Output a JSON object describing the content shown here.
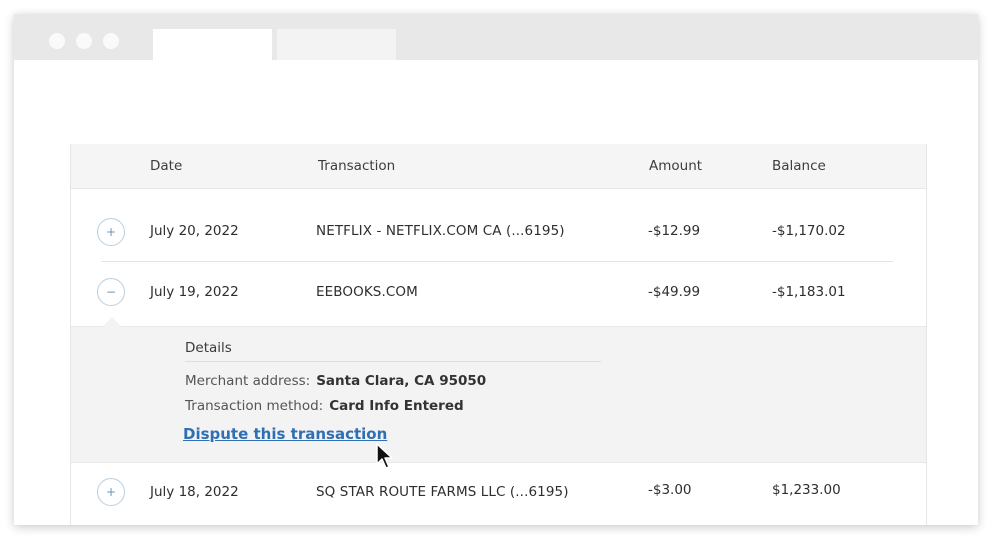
{
  "table": {
    "headers": {
      "date": "Date",
      "transaction": "Transaction",
      "amount": "Amount",
      "balance": "Balance"
    },
    "rows": [
      {
        "toggle": "+",
        "date": "July 20, 2022",
        "transaction": "NETFLIX - NETFLIX.COM  CA (...6195)",
        "amount": "-$12.99",
        "balance": "-$1,170.02"
      },
      {
        "toggle": "−",
        "date": "July 19, 2022",
        "transaction": "EEBOOKS.COM",
        "amount": "-$49.99",
        "balance": "-$1,183.01"
      },
      {
        "toggle": "+",
        "date": "July 18, 2022",
        "transaction": "SQ STAR ROUTE FARMS LLC (...6195)",
        "amount": "-$3.00",
        "balance": "$1,233.00"
      }
    ]
  },
  "details": {
    "title": "Details",
    "merchant_label": "Merchant address:",
    "merchant_value": "Santa Clara, CA 95050",
    "method_label": "Transaction method:",
    "method_value": "Card Info Entered",
    "dispute_link": "Dispute this transaction"
  },
  "colors": {
    "link": "#2f6fb3",
    "toggle_border": "#b8cfe0",
    "header_bg": "#f5f5f5",
    "details_bg": "#f3f3f3"
  },
  "icons": {
    "expand": "plus-icon",
    "collapse": "minus-icon",
    "cursor": "mouse-pointer-icon"
  }
}
